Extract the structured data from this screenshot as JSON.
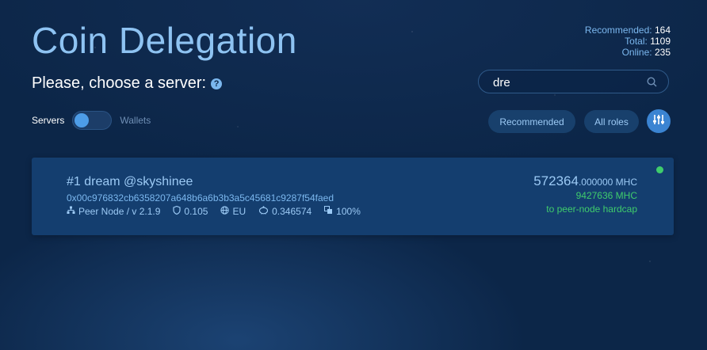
{
  "header": {
    "title": "Coin Delegation",
    "stats": {
      "recommended_label": "Recommended:",
      "recommended_value": "164",
      "total_label": "Total:",
      "total_value": "1109",
      "online_label": "Online:",
      "online_value": "235"
    }
  },
  "prompt": {
    "text": "Please, choose a server:",
    "help_icon": "?"
  },
  "search": {
    "value": "dre",
    "placeholder": ""
  },
  "toggle": {
    "left_label": "Servers",
    "right_label": "Wallets",
    "state": "servers"
  },
  "filters": {
    "recommended_label": "Recommended",
    "all_roles_label": "All roles"
  },
  "servers": [
    {
      "title": "#1 dream @skyshinee",
      "address": "0x00c976832cb6358207a648b6a6b3b3a5c45681c9287f54faed",
      "role": "Peer Node / v 2.1.9",
      "rating": "0.105",
      "region": "EU",
      "fee": "0.346574",
      "percent": "100%",
      "amount_int": "572364",
      "amount_dec": ".000000 MHC",
      "hardcap_amount": "9427636 MHC",
      "hardcap_label": "to peer-node hardcap",
      "status_color": "#3fcc6c"
    }
  ],
  "colors": {
    "background": "#0c2648",
    "accent": "#3b84d2",
    "title": "#8ec3f2",
    "online": "#3fcc6c"
  }
}
